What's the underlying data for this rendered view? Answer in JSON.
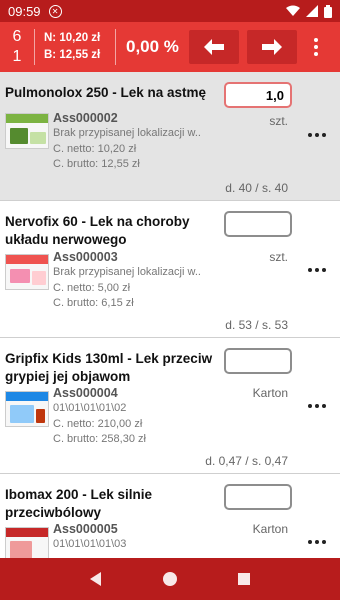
{
  "status_bar": {
    "time": "09:59",
    "icons": [
      "data-saver-icon",
      "wifi-icon",
      "signal-icon",
      "battery-icon"
    ]
  },
  "header": {
    "count_top": "6",
    "count_bottom": "1",
    "net_sum": "N: 10,20 zł",
    "gross_sum": "B: 12,55 zł",
    "discount": "0,00 %",
    "buttons": [
      "arrow-left-icon",
      "arrow-right-icon",
      "more-vert-icon"
    ]
  },
  "items": [
    {
      "title": "Pulmonolox 250 - Lek na astmę",
      "qty": "1,0",
      "code": "Ass000002",
      "unit": "szt.",
      "location": "Brak przypisanej lokalizacji w..",
      "net": "C. netto: 10,20 zł",
      "gross": "C. brutto: 12,55 zł",
      "stock": "d. 40 / s. 40"
    },
    {
      "title": "Nervofix 60 - Lek na choroby układu nerwowego",
      "qty": "",
      "code": "Ass000003",
      "unit": "szt.",
      "location": "Brak przypisanej lokalizacji w..",
      "net": "C. netto: 5,00 zł",
      "gross": "C. brutto: 6,15 zł",
      "stock": "d. 53 / s. 53"
    },
    {
      "title": "Gripfix Kids 130ml - Lek przeciw grypiej jej objawom",
      "qty": "",
      "code": "Ass000004",
      "unit": "Karton",
      "location": "01\\01\\01\\01\\02",
      "net": "C. netto: 210,00 zł",
      "gross": "C. brutto: 258,30 zł",
      "stock": "d. 0,47 / s. 0,47"
    },
    {
      "title": "Ibomax 200 - Lek silnie przeciwbólowy",
      "qty": "",
      "code": "Ass000005",
      "unit": "Karton",
      "location": "01\\01\\01\\01\\03"
    }
  ],
  "nav": [
    "back-icon",
    "home-icon",
    "recents-icon"
  ]
}
